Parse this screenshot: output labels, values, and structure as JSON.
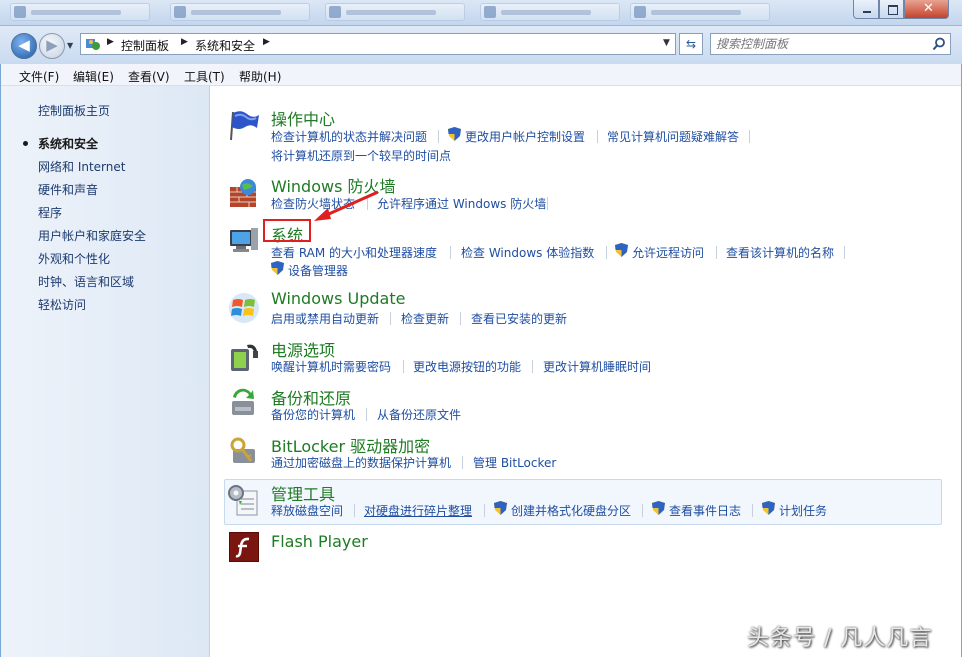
{
  "address": {
    "crumbs": [
      "控制面板",
      "系统和安全"
    ]
  },
  "search": {
    "placeholder": "搜索控制面板"
  },
  "menu": [
    "文件(F)",
    "编辑(E)",
    "查看(V)",
    "工具(T)",
    "帮助(H)"
  ],
  "left_nav": {
    "home": "控制面板主页",
    "current": "系统和安全",
    "items": [
      "网络和 Internet",
      "硬件和声音",
      "程序",
      "用户帐户和家庭安全",
      "外观和个性化",
      "时钟、语言和区域",
      "轻松访问"
    ]
  },
  "categories": {
    "action_center": {
      "title": "操作中心",
      "links": [
        "检查计算机的状态并解决问题",
        "更改用户帐户控制设置",
        "常见计算机问题疑难解答",
        "将计算机还原到一个较早的时间点"
      ]
    },
    "firewall": {
      "title": "Windows 防火墙",
      "links": [
        "检查防火墙状态",
        "允许程序通过 Windows 防火墙"
      ]
    },
    "system": {
      "title": "系统",
      "links": [
        "查看 RAM 的大小和处理器速度",
        "检查 Windows 体验指数",
        "允许远程访问",
        "查看该计算机的名称",
        "设备管理器"
      ]
    },
    "windows_update": {
      "title": "Windows Update",
      "links": [
        "启用或禁用自动更新",
        "检查更新",
        "查看已安装的更新"
      ]
    },
    "power": {
      "title": "电源选项",
      "links": [
        "唤醒计算机时需要密码",
        "更改电源按钮的功能",
        "更改计算机睡眠时间"
      ]
    },
    "backup": {
      "title": "备份和还原",
      "links": [
        "备份您的计算机",
        "从备份还原文件"
      ]
    },
    "bitlocker": {
      "title": "BitLocker 驱动器加密",
      "links": [
        "通过加密磁盘上的数据保护计算机",
        "管理 BitLocker"
      ]
    },
    "admin_tools": {
      "title": "管理工具",
      "links": [
        "释放磁盘空间",
        "对硬盘进行碎片整理",
        "创建并格式化硬盘分区",
        "查看事件日志",
        "计划任务"
      ]
    },
    "flash": {
      "title": "Flash Player"
    }
  },
  "watermark": "头条号 / 凡人凡言",
  "colors": {
    "title_green": "#1e7b23",
    "link_blue": "#1f4ea1",
    "highlight_red": "#e02020"
  }
}
